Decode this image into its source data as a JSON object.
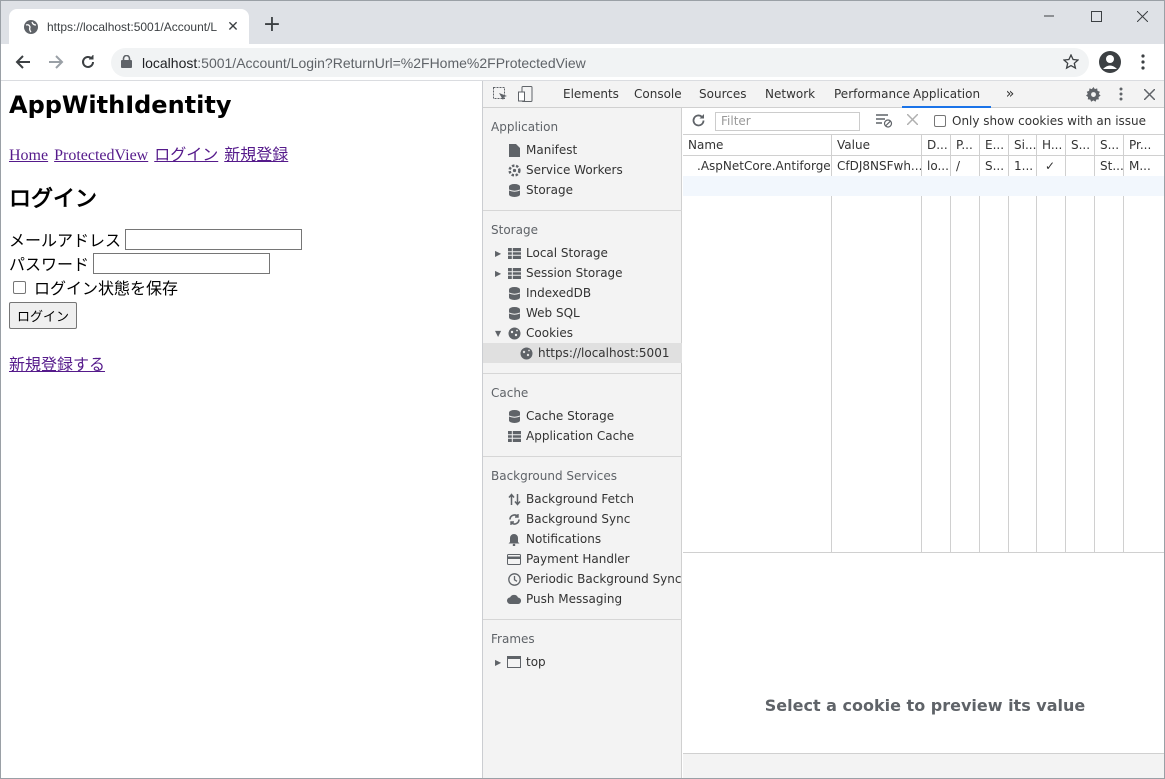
{
  "browser": {
    "tab_title": "https://localhost:5001/Account/L",
    "url_host": "localhost",
    "url_rest": ":5001/Account/Login?ReturnUrl=%2FHome%2FProtectedView"
  },
  "page": {
    "title": "AppWithIdentity",
    "nav": [
      "Home",
      "ProtectedView",
      "ログイン",
      "新規登録"
    ],
    "heading": "ログイン",
    "email_label": "メールアドレス",
    "password_label": "パスワード",
    "remember_label": "ログイン状態を保存",
    "login_button": "ログイン",
    "register_link": "新規登録する"
  },
  "devtools": {
    "tabs": [
      "Elements",
      "Console",
      "Sources",
      "Network",
      "Performance",
      "Application"
    ],
    "active_tab": "Application",
    "sidebar": {
      "application": {
        "title": "Application",
        "items": [
          "Manifest",
          "Service Workers",
          "Storage"
        ]
      },
      "storage": {
        "title": "Storage",
        "items": [
          "Local Storage",
          "Session Storage",
          "IndexedDB",
          "Web SQL",
          "Cookies",
          "https://localhost:5001"
        ]
      },
      "cache": {
        "title": "Cache",
        "items": [
          "Cache Storage",
          "Application Cache"
        ]
      },
      "background": {
        "title": "Background Services",
        "items": [
          "Background Fetch",
          "Background Sync",
          "Notifications",
          "Payment Handler",
          "Periodic Background Sync",
          "Push Messaging"
        ]
      },
      "frames": {
        "title": "Frames",
        "items": [
          "top"
        ]
      }
    },
    "filter_placeholder": "Filter",
    "only_issue_label": "Only show cookies with an issue",
    "columns": [
      "Name",
      "Value",
      "D...",
      "P...",
      "E...",
      "Si...",
      "H...",
      "S...",
      "S...",
      "Pr..."
    ],
    "rows": [
      [
        ".AspNetCore.Antiforge...",
        "CfDJ8NSFwh...",
        "lo...",
        "/",
        "S...",
        "1...",
        "✓",
        "",
        "St...",
        "M..."
      ]
    ],
    "preview_text": "Select a cookie to preview its value"
  }
}
